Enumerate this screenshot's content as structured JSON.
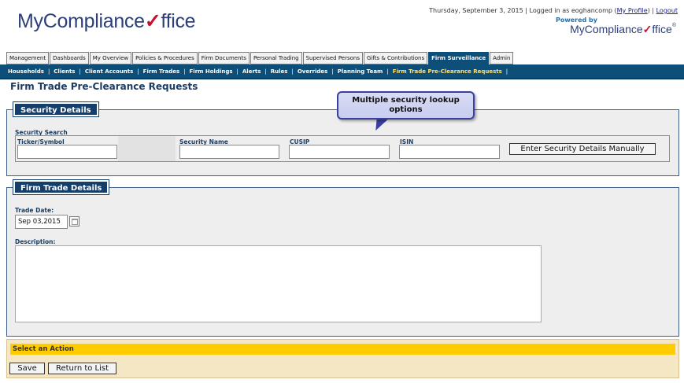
{
  "header": {
    "logo_text": "MyCompliance",
    "logo_check": "✓",
    "logo_suffix": "ffice",
    "date_text": "Thursday, September 3, 2015 | Logged in as eoghancomp (",
    "my_profile": "My Profile",
    "mid_sep": ") | ",
    "logout": "Logout",
    "powered_by": "Powered by",
    "mini_logo_text": "MyCompliance",
    "mini_logo_suffix": "ffice",
    "mini_logo_tm": "®"
  },
  "tabs": [
    {
      "label": "Management"
    },
    {
      "label": "Dashboards"
    },
    {
      "label": "My Overview"
    },
    {
      "label": "Policies & Procedures"
    },
    {
      "label": "Firm Documents"
    },
    {
      "label": "Personal Trading"
    },
    {
      "label": "Supervised Persons"
    },
    {
      "label": "Gifts & Contributions"
    },
    {
      "label": "Firm Surveillance",
      "active": true
    },
    {
      "label": "Admin"
    }
  ],
  "subnav": [
    {
      "label": "Households"
    },
    {
      "label": "Clients"
    },
    {
      "label": "Client Accounts"
    },
    {
      "label": "Firm Trades"
    },
    {
      "label": "Firm Holdings"
    },
    {
      "label": "Alerts"
    },
    {
      "label": "Rules"
    },
    {
      "label": "Overrides"
    },
    {
      "label": "Planning Team"
    },
    {
      "label": "Firm Trade Pre-Clearance Requests",
      "active": true
    }
  ],
  "page_title": "Firm Trade Pre-Clearance Requests",
  "security": {
    "legend": "Security Details",
    "search_label": "Security Search",
    "ticker_label": "Ticker/Symbol",
    "name_label": "Security Name",
    "cusip_label": "CUSIP",
    "isin_label": "ISIN",
    "ticker_value": "",
    "name_value": "",
    "cusip_value": "",
    "isin_value": "",
    "manual_button": "Enter Security Details Manually"
  },
  "callout": {
    "line1": "Multiple security lookup",
    "line2": "options"
  },
  "trade": {
    "legend": "Firm Trade Details",
    "date_label": "Trade Date:",
    "date_value": "Sep 03,2015",
    "desc_label": "Description:",
    "desc_value": ""
  },
  "actions": {
    "bar_label": "Select an Action",
    "save": "Save",
    "return": "Return to List"
  },
  "colors": {
    "nav_bg": "#0d4f78",
    "legend_bg": "#143e6b",
    "action_bar": "#ffcc00",
    "action_bg": "#f5e6c4"
  }
}
